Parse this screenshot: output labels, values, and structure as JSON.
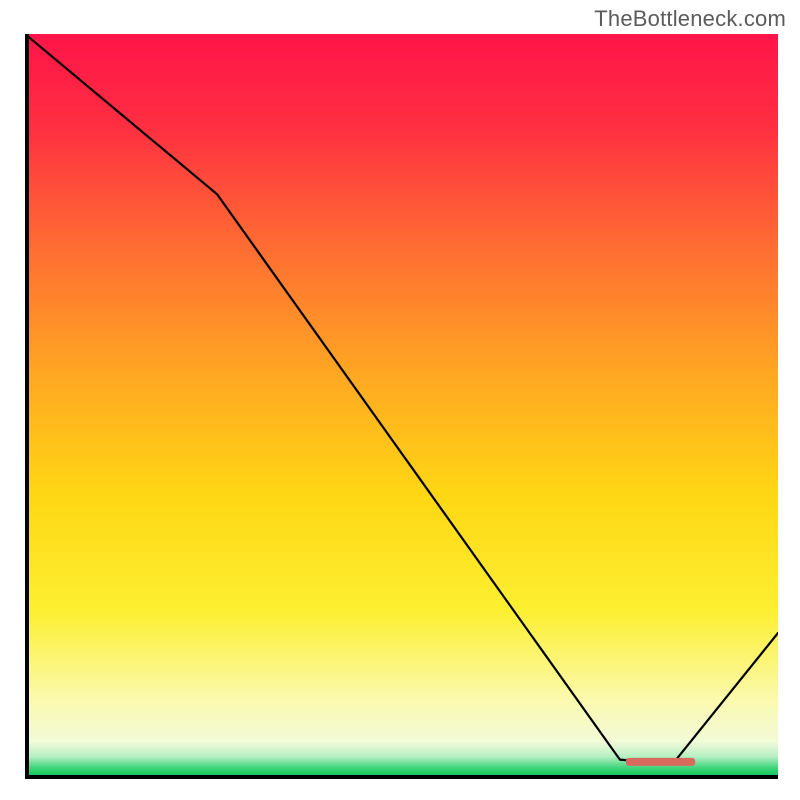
{
  "watermark": "TheBottleneck.com",
  "chart_data": {
    "type": "line",
    "title": "",
    "xlabel": "",
    "ylabel": "",
    "xlim": [
      0,
      100
    ],
    "ylim": [
      0,
      100
    ],
    "grid": false,
    "series": [
      {
        "name": "curve",
        "color": "#000000",
        "x": [
          0,
          25.5,
          79,
          86,
          100
        ],
        "y": [
          100,
          78.5,
          2.6,
          2.0,
          19.6
        ]
      }
    ],
    "marker": {
      "name": "min-region",
      "shape": "rounded-bar",
      "color": "#d96b5e",
      "x_range": [
        79.8,
        89.0
      ],
      "y": 2.3
    },
    "background_gradient_stops": [
      {
        "pos": 0.0,
        "color": "#ff1549"
      },
      {
        "pos": 0.12,
        "color": "#ff2e42"
      },
      {
        "pos": 0.28,
        "color": "#ff6a34"
      },
      {
        "pos": 0.45,
        "color": "#ffa524"
      },
      {
        "pos": 0.62,
        "color": "#ffd714"
      },
      {
        "pos": 0.78,
        "color": "#fdf032"
      },
      {
        "pos": 0.9,
        "color": "#fbfab0"
      },
      {
        "pos": 0.955,
        "color": "#f2fbd8"
      },
      {
        "pos": 0.975,
        "color": "#b8f0c4"
      },
      {
        "pos": 0.99,
        "color": "#3fd77d"
      },
      {
        "pos": 1.0,
        "color": "#17c85d"
      }
    ]
  }
}
